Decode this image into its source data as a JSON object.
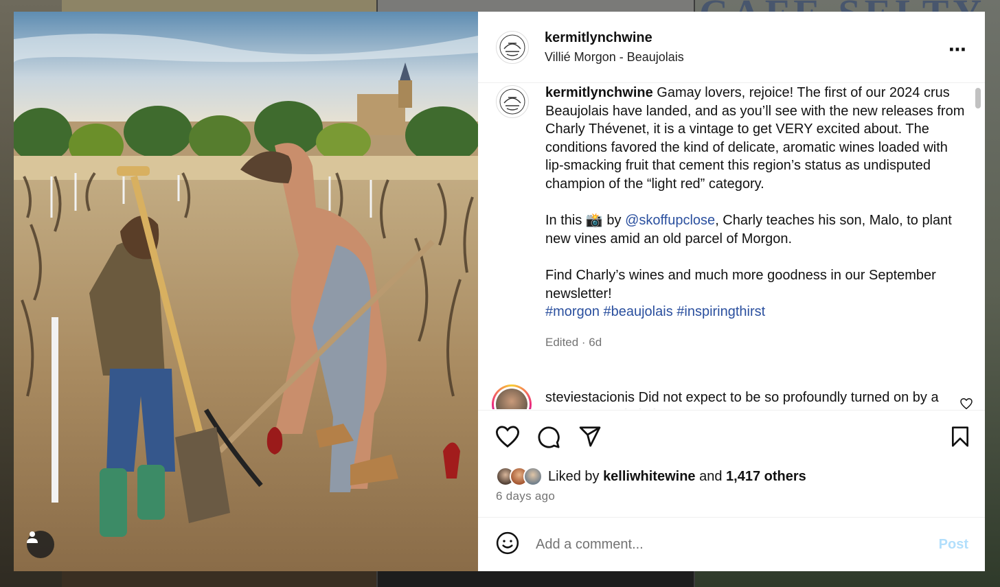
{
  "background": {
    "partial_heading": "CAFÉ SELTY"
  },
  "post": {
    "username": "kermitlynchwine",
    "location": "Villié Morgon - Beaujolais",
    "more_icon": "⋯",
    "caption": {
      "username": "kermitlynchwine",
      "paragraph1": "Gamay lovers, rejoice! The first of our 2024 crus Beaujolais have landed, and as you’ll see with the new releases from Charly Thévenet, it is a vintage to get VERY excited about. The conditions favored the kind of delicate, aromatic wines loaded with lip-smacking fruit that cement this region’s status as undisputed champion of the “light red” category.",
      "p2_prefix": "In this 📸 by ",
      "p2_mention": "@skoffupclose",
      "p2_suffix": ", Charly teaches his son, Malo, to plant new vines amid an old parcel of Morgon.",
      "paragraph3": "Find Charly’s wines and much more goodness in our September newsletter!",
      "hashtags": [
        "#morgon",
        "#beaujolais",
        "#inspiringthirst"
      ],
      "meta": "Edited · 6d"
    },
    "comment": {
      "username": "steviestacionis",
      "text": "Did not expect to be so profoundly turned on by a Kermit post 😍😊😋"
    },
    "likes": {
      "prefix": "Liked by ",
      "first_user": "kelliwhitewine",
      "middle": " and ",
      "others": "1,417 others"
    },
    "time_ago": "6 days ago",
    "add_comment": {
      "placeholder": "Add a comment...",
      "post_label": "Post"
    },
    "colors": {
      "link": "#2a4f9e",
      "post_disabled": "#b2dffc",
      "meta_gray": "#737373"
    }
  }
}
